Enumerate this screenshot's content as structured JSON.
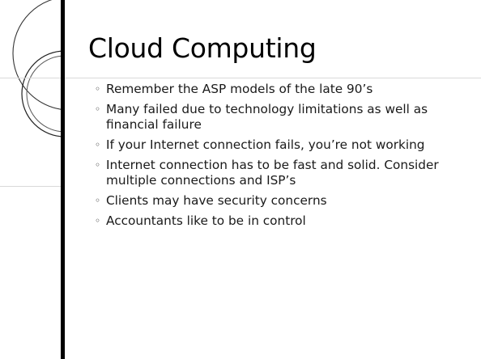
{
  "slide": {
    "title": "Cloud Computing",
    "bullet_icon": "hollow-circle-bullet",
    "bullets": [
      "Remember the ASP models of the late 90’s",
      "Many failed due to technology limitations as well as financial failure",
      "If your Internet connection fails, you’re not working",
      "Internet connection has to be fast and solid. Consider multiple connections and ISP’s",
      "Clients may have security concerns",
      "Accountants like to be in control"
    ]
  },
  "colors": {
    "background": "#ffffff",
    "text": "#000000",
    "accent_bar": "#000000",
    "rule": "#d9d9d9"
  }
}
